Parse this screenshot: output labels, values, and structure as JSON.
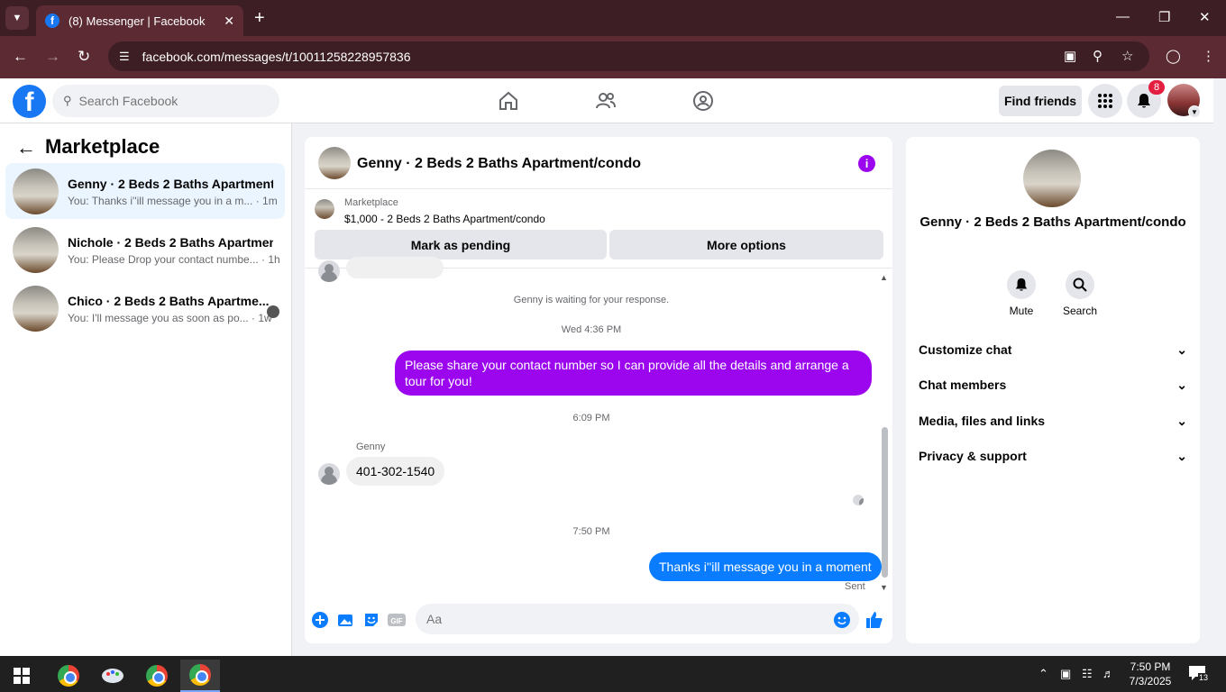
{
  "browser": {
    "tab_title": "(8) Messenger | Facebook",
    "url": "facebook.com/messages/t/10011258228957836"
  },
  "fb_header": {
    "search_placeholder": "Search Facebook",
    "find_friends": "Find friends",
    "notification_count": "8"
  },
  "left_panel": {
    "title": "Marketplace",
    "conversations": [
      {
        "name": "Genny · 2 Beds 2 Baths Apartment...",
        "preview": "You: Thanks i''ill message you in a m...",
        "time": "· 1m"
      },
      {
        "name": "Nichole · 2 Beds 2 Baths Apartmen...",
        "preview": "You: Please Drop your contact numbe...",
        "time": "· 1h"
      },
      {
        "name": "Chico · 2 Beds 2 Baths Apartme...",
        "preview": "You: I'll message you as soon as po...",
        "time": "· 1w"
      }
    ]
  },
  "chat": {
    "header_name": "Genny · 2 Beds 2 Baths Apartment/condo",
    "listing_category": "Marketplace",
    "listing_desc": "$1,000 - 2 Beds 2 Baths Apartment/condo",
    "mark_pending": "Mark as pending",
    "more_options": "More options",
    "waiting": "Genny is waiting for your response.",
    "ts1": "Wed 4:36 PM",
    "msg1": "Please share your contact number so I can provide all the details and arrange a tour for you!",
    "ts2": "6:09 PM",
    "sender": "Genny",
    "msg2": "401-302-1540",
    "ts3": "7:50 PM",
    "msg3": "Thanks i''ill message you in a moment",
    "sent": "Sent",
    "composer_placeholder": "Aa",
    "colors": {
      "accent_purple": "#9b06ee",
      "accent_blue": "#0a7cff"
    }
  },
  "right_panel": {
    "name": "Genny · 2 Beds 2 Baths Apartment/condo",
    "mute": "Mute",
    "search": "Search",
    "sections": [
      "Customize chat",
      "Chat members",
      "Media, files and links",
      "Privacy & support"
    ]
  },
  "taskbar": {
    "time": "7:50 PM",
    "date": "7/3/2025",
    "notif_count": "13"
  }
}
